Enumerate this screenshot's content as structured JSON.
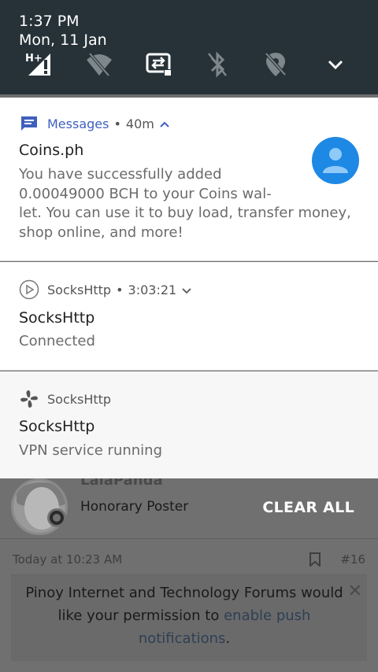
{
  "status": {
    "time": "1:37 PM",
    "date": "Mon, 11 Jan",
    "network_label": "H+",
    "icons": [
      "signal-hplus-icon",
      "wifi-off-icon",
      "data-saver-icon",
      "bluetooth-off-icon",
      "location-off-icon",
      "expand-chevron-icon"
    ]
  },
  "notifications": [
    {
      "app": "Messages",
      "time": "40m",
      "title": "Coins.ph",
      "body_lines": [
        "You have successfully added",
        "0.00049000 BCH to your Coins wal-",
        "let. You can use it to buy load, transfer money,",
        "shop online, and more!"
      ],
      "accent": "#3f5fbf"
    },
    {
      "app": "SocksHttp",
      "time": "3:03:21",
      "title": "SocksHttp",
      "body": "Connected"
    },
    {
      "app": "SocksHttp",
      "title": "SocksHttp",
      "body": "VPN service running"
    }
  ],
  "background": {
    "username": "LalaPanda",
    "user_title": "Honorary Poster",
    "clear_all": "CLEAR ALL",
    "post_date": "Today at 10:23 AM",
    "post_number": "#16",
    "push_text_1": "Pinoy Internet and Technology Forums would",
    "push_text_2a": "like your permission to ",
    "push_text_2b": "enable push",
    "push_text_3a": "notifications",
    "push_text_3b": ".",
    "push_close": "✕"
  },
  "colors": {
    "statusbar": "#263238",
    "avatar_blue": "#1e88e5"
  }
}
